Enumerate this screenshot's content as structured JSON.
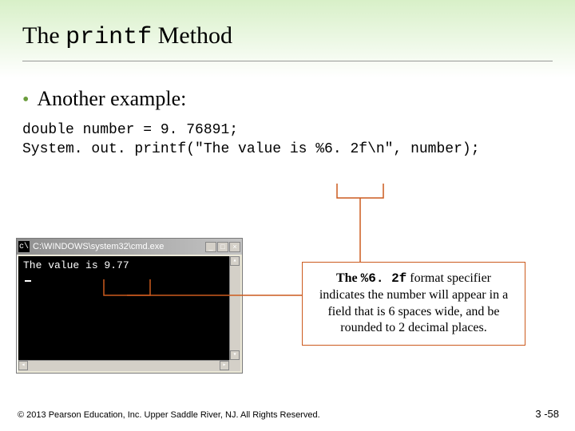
{
  "title": {
    "pre": "The ",
    "mono": "printf",
    "post": " Method"
  },
  "bullet": "Another example:",
  "code": {
    "line1": "double number = 9. 76891;",
    "line2": "System. out. printf(\"The value is %6. 2f\\n\", number);"
  },
  "console": {
    "title": "C:\\WINDOWS\\system32\\cmd.exe",
    "output": "The value is   9.77"
  },
  "callout": {
    "pre": "The ",
    "mono": "%6. 2f",
    "post": " format specifier indicates the number will appear in a field that is 6 spaces wide, and be rounded to 2 decimal places."
  },
  "footer": "© 2013 Pearson Education, Inc. Upper Saddle River, NJ. All Rights Reserved.",
  "pagenum": "3 -58"
}
